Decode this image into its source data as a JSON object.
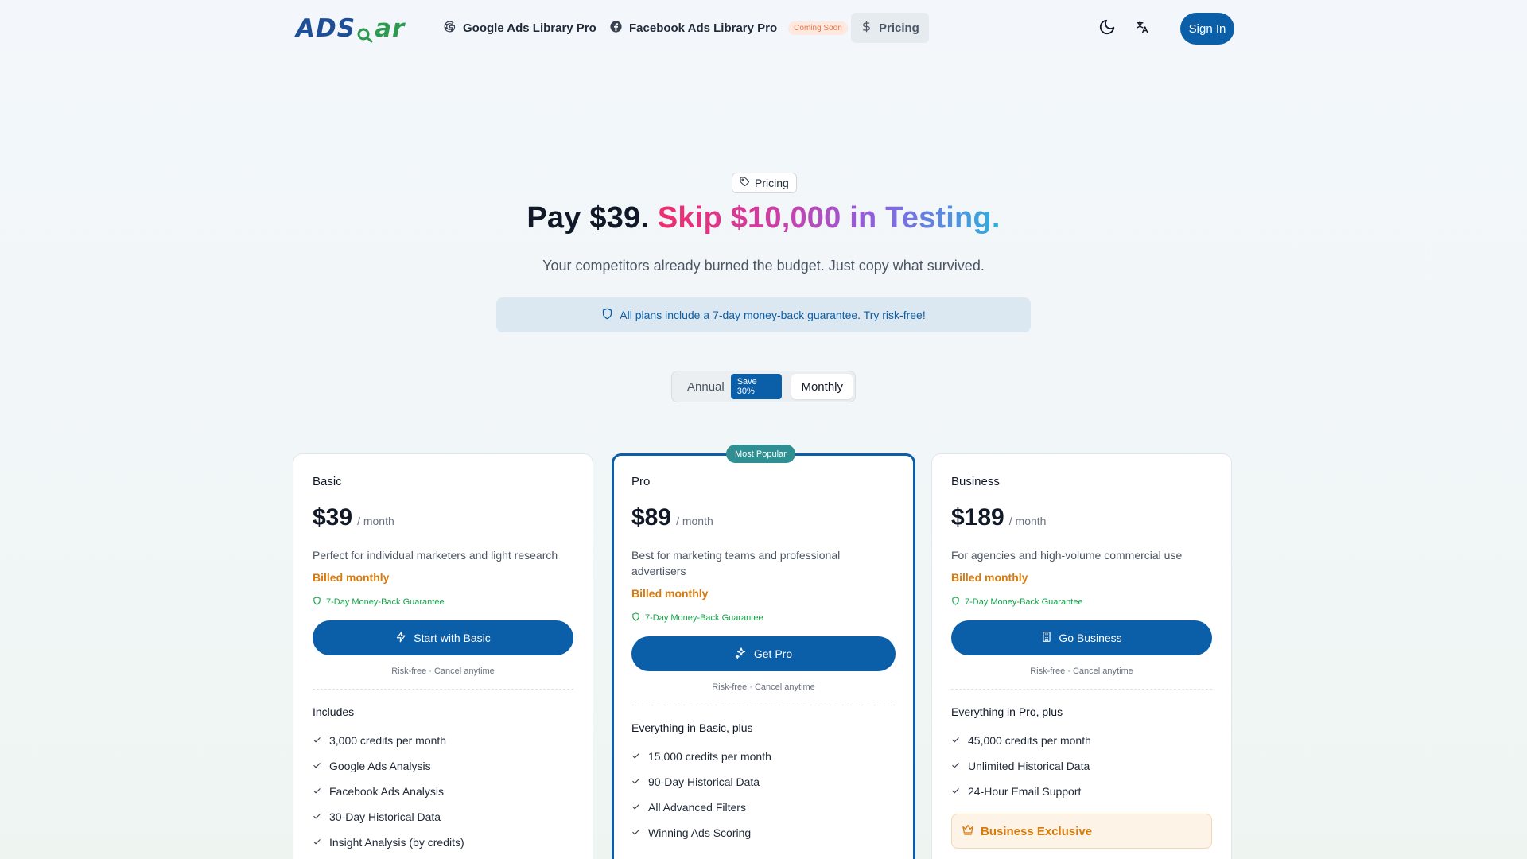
{
  "nav": {
    "logo_part1": "ADS",
    "logo_part2": "ar",
    "google_label": "Google Ads Library Pro",
    "facebook_label": "Facebook Ads Library Pro",
    "coming_soon": "Coming Soon",
    "pricing_label": "Pricing",
    "signin_label": "Sign In"
  },
  "hero": {
    "badge": "Pricing",
    "headline_plain": "Pay $39.",
    "headline_gradient": "Skip $10,000 in Testing.",
    "subline": "Your competitors already burned the budget. Just copy what survived.",
    "guarantee": "All plans include a 7-day money-back guarantee. Try risk-free!"
  },
  "billing_toggle": {
    "annual": "Annual",
    "save": "Save 30%",
    "monthly": "Monthly",
    "selected": "Monthly"
  },
  "plans": [
    {
      "name": "Basic",
      "price": "$39",
      "per": "/ month",
      "description": "Perfect for individual marketers and light research",
      "billed": "Billed monthly",
      "guarantee": "7-Day Money-Back Guarantee",
      "cta": "Start with Basic",
      "cta_icon": "lightning-icon",
      "risk": "Risk-free · Cancel anytime",
      "includes_title": "Includes",
      "features": [
        "3,000 credits per month",
        "Google Ads Analysis",
        "Facebook Ads Analysis",
        "30-Day Historical Data",
        "Insight Analysis (by credits)"
      ]
    },
    {
      "name": "Pro",
      "badge": "Most Popular",
      "price": "$89",
      "per": "/ month",
      "description": "Best for marketing teams and professional advertisers",
      "billed": "Billed monthly",
      "guarantee": "7-Day Money-Back Guarantee",
      "cta": "Get Pro",
      "cta_icon": "sparkles-icon",
      "risk": "Risk-free · Cancel anytime",
      "includes_title": "Everything in Basic, plus",
      "features": [
        "15,000 credits per month",
        "90-Day Historical Data",
        "All Advanced Filters",
        "Winning Ads Scoring"
      ]
    },
    {
      "name": "Business",
      "price": "$189",
      "per": "/ month",
      "description": "For agencies and high-volume commercial use",
      "billed": "Billed monthly",
      "guarantee": "7-Day Money-Back Guarantee",
      "cta": "Go Business",
      "cta_icon": "building-icon",
      "risk": "Risk-free · Cancel anytime",
      "includes_title": "Everything in Pro, plus",
      "features": [
        "45,000 credits per month",
        "Unlimited Historical Data",
        "24-Hour Email Support"
      ],
      "exclusive": "Business Exclusive"
    }
  ],
  "colors": {
    "primary": "#0b5ea8",
    "accent_orange": "#d97a0b",
    "success_green": "#16a34a",
    "popular_teal": "#2f8f92"
  }
}
